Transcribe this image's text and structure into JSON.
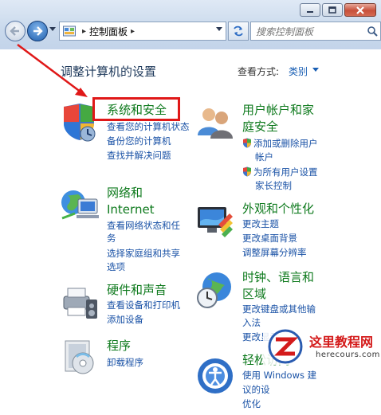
{
  "window": {
    "buttons": [
      "minimize",
      "maximize",
      "close"
    ]
  },
  "address": {
    "breadcrumb": "控制面板",
    "sep": "▸",
    "search_placeholder": "搜索控制面板"
  },
  "header": {
    "title": "调整计算机的设置",
    "view_by_label": "查看方式:",
    "view_by_value": "类别"
  },
  "categories": [
    {
      "name": "system-security",
      "title": "系统和安全",
      "links": [
        "查看您的计算机状态",
        "备份您的计算机",
        "查找并解决问题"
      ]
    },
    {
      "name": "network-internet",
      "title_lines": [
        "网络和",
        "Internet"
      ],
      "links": [
        "查看网络状态和任",
        "务",
        "选择家庭组和共享",
        "选项"
      ]
    },
    {
      "name": "hardware-sound",
      "title": "硬件和声音",
      "links": [
        "查看设备和打印机",
        "添加设备"
      ]
    },
    {
      "name": "programs",
      "title": "程序",
      "links": [
        "卸载程序"
      ]
    },
    {
      "name": "user-accounts",
      "title_lines": [
        "用户帐户和家",
        "庭安全"
      ],
      "links": [
        "添加或删除用户",
        "帐户",
        "为所有用户设置",
        "家长控制"
      ]
    },
    {
      "name": "appearance",
      "title": "外观和个性化",
      "links": [
        "更改主题",
        "更改桌面背景",
        "调整屏幕分辨率"
      ]
    },
    {
      "name": "clock-language",
      "title_lines": [
        "时钟、语言和",
        "区域"
      ],
      "links": [
        "更改键盘或其他输",
        "入法",
        "更改显示语言"
      ]
    },
    {
      "name": "ease-access",
      "title": "轻松访问",
      "links": [
        "使用 Windows 建",
        "议的设",
        "优化"
      ]
    }
  ],
  "watermark": {
    "text": "这里教程网",
    "sub": "herecours.com"
  },
  "colors": {
    "link": "#1a52a6",
    "category_title": "#0e7a1d",
    "highlight": "#e01818"
  }
}
